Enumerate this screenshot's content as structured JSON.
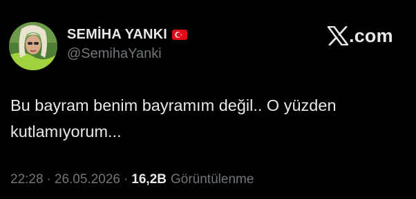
{
  "author": {
    "display_name": "SEMİHA YANKI",
    "handle": "@SemihaYanki",
    "flag_icon": "turkey-flag-icon"
  },
  "brand": {
    "logo_icon": "x-logo-icon",
    "text": ".com"
  },
  "tweet": {
    "lines": [
      "Bu bayram benim bayramım değil.. O yüzden",
      "kutlamıyorum..."
    ]
  },
  "meta": {
    "time": "22:28",
    "separator": "·",
    "date": "26.05.2026",
    "views_count": "16,2B",
    "views_label": "Görüntülenme"
  },
  "colors": {
    "background": "#000000",
    "primary_text": "#e7e9ea",
    "secondary_text": "#71767b",
    "flag_red": "#e30a17"
  }
}
